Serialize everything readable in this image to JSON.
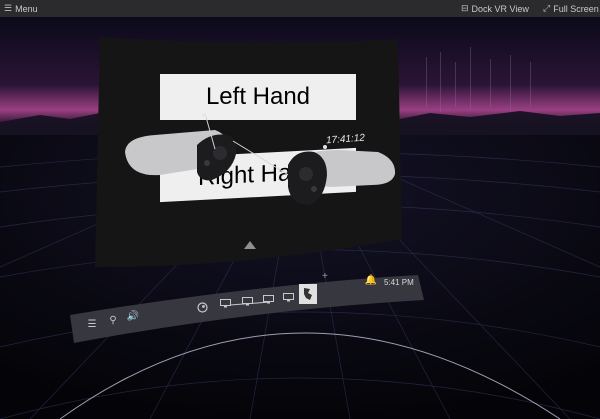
{
  "topbar": {
    "menu_label": "Menu",
    "dock_label": "Dock VR View",
    "fullscreen_label": "Full Screen",
    "menu_icon": "hamburger-icon",
    "dock_icon": "dock-icon",
    "fullscreen_icon": "expand-icon"
  },
  "vr": {
    "left_label": "Left Hand",
    "right_label": "Right Hand",
    "clock": "17:41:12"
  },
  "dashboard": {
    "time": "5:41 PM",
    "plus": "+",
    "icons": [
      "menu-icon",
      "person-icon",
      "volume-icon",
      "steam-icon",
      "desktop-icon",
      "desktop-icon",
      "desktop-icon",
      "desktop-icon",
      "app-thumbnail",
      "notification-icon"
    ]
  },
  "colors": {
    "topbar_bg": "#2b2b2e",
    "horizon_glow": "#b04a90",
    "panel_bg": "#151515",
    "label_bg": "#efefef",
    "dashboard_bg": "#3a3a42"
  }
}
